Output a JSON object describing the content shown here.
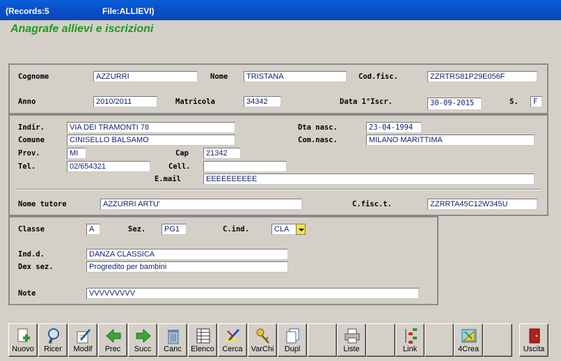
{
  "window": {
    "records": "(Records:5",
    "file": "File:ALLIEVI)"
  },
  "form_title": "Anagrafe allievi e iscrizioni",
  "labels": {
    "cognome": "Cognome",
    "nome": "Nome",
    "codfisc": "Cod.fisc.",
    "anno": "Anno",
    "matricola": "Matricola",
    "data_iscr": "Data 1°Iscr.",
    "sesso": "S.",
    "indir": "Indir.",
    "dta_nasc": "Dta nasc.",
    "comune": "Comune",
    "com_nasc": "Com.nasc.",
    "prov": "Prov.",
    "cap": "Cap",
    "tel": "Tel.",
    "cell": "Cell.",
    "email": "E.mail",
    "nome_tutore": "Nome tutore",
    "cfisc_t": "C.fisc.t.",
    "classe": "Classe",
    "sez": "Sez.",
    "c_ind": "C.ind.",
    "ind_d": "Ind.d.",
    "dex_sez": "Dex sez.",
    "note": "Note"
  },
  "values": {
    "cognome": "AZZURRI",
    "nome": "TRISTANA",
    "codfisc": "ZZRTRS81P29E056F",
    "anno": "2010/2011",
    "matricola": "34342",
    "data_iscr": "30-09-2015",
    "sesso": "F",
    "indir": "VIA DEI TRAMONTI 78",
    "dta_nasc": "23-04-1994",
    "comune": "CINISELLO BALSAMO",
    "com_nasc": "MILANO MARITTIMA",
    "prov": "MI",
    "cap": "21342",
    "tel": "02/654321",
    "cell": "",
    "email": "EEEEEEEEEE",
    "nome_tutore": "AZZURRI ARTU'",
    "cfisc_t": "ZZRRTA45C12W345U",
    "classe": "A",
    "sez": "PG1",
    "c_ind": "CLA",
    "ind_d": "DANZA CLASSICA",
    "dex_sez": "Progredito per bambini",
    "note": "VVVVVVVVV"
  },
  "toolbar": [
    {
      "name": "nuovo",
      "label": "Nuovo",
      "icon": "new-document-icon"
    },
    {
      "name": "ricer",
      "label": "Ricer",
      "icon": "magnifier-icon"
    },
    {
      "name": "modif",
      "label": "Modif",
      "icon": "edit-document-icon"
    },
    {
      "name": "prec",
      "label": "Prec",
      "icon": "arrow-left-icon"
    },
    {
      "name": "succ",
      "label": "Succ",
      "icon": "arrow-right-icon"
    },
    {
      "name": "canc",
      "label": "Canc",
      "icon": "trash-icon"
    },
    {
      "name": "elenco",
      "label": "Elenco",
      "icon": "list-icon"
    },
    {
      "name": "cerca",
      "label": "Cerca",
      "icon": "highlighter-icon"
    },
    {
      "name": "varchi",
      "label": "VarChi",
      "icon": "keys-icon"
    },
    {
      "name": "dupl",
      "label": "Dupl",
      "icon": "copy-icon"
    },
    {
      "name": "empty1",
      "label": "",
      "icon": ""
    },
    {
      "name": "liste",
      "label": "Liste",
      "icon": "printer-icon"
    },
    {
      "name": "empty2",
      "label": "",
      "icon": ""
    },
    {
      "name": "link",
      "label": "Link",
      "icon": "tree-icon"
    },
    {
      "name": "empty3",
      "label": "",
      "icon": ""
    },
    {
      "name": "4crea",
      "label": "4Crea",
      "icon": "design-icon"
    },
    {
      "name": "empty4",
      "label": "",
      "icon": ""
    },
    {
      "name": "uscita",
      "label": "Uscita",
      "icon": "exit-door-icon"
    }
  ],
  "colors": {
    "title_green": "#1f9a1f",
    "field_text": "#102070",
    "titlebar_blue": "#0a4fc8"
  }
}
